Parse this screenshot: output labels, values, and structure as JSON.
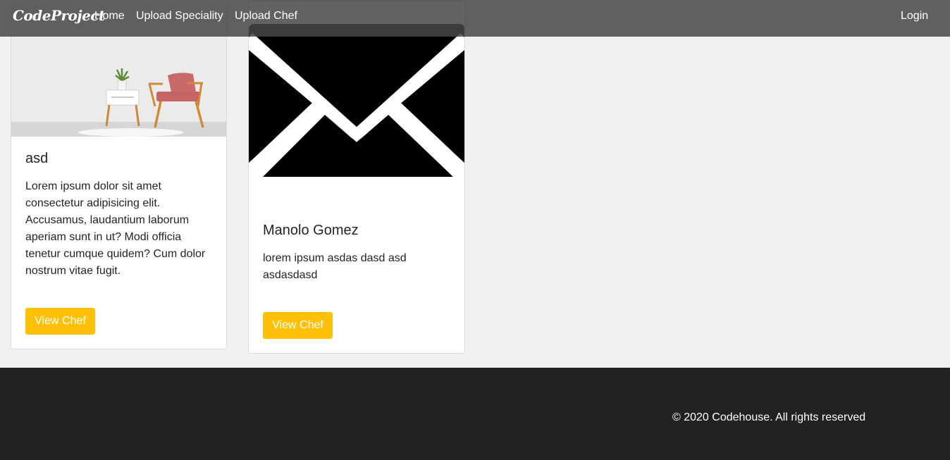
{
  "navbar": {
    "brand": "CodeProject",
    "links": [
      "Home",
      "Upload Speciality",
      "Upload Chef"
    ],
    "login": "Login"
  },
  "cards": [
    {
      "image": "room-chair-photo",
      "title": "asd",
      "text": "Lorem ipsum dolor sit amet consectetur adipisicing elit. Accusamus, laudantium laborum aperiam sunt in ut? Modi officia tenetur cumque quidem? Cum dolor nostrum vitae fugit.",
      "button": "View Chef"
    },
    {
      "image": "envelope-icon",
      "title": "Manolo Gomez",
      "text": "lorem ipsum asdas dasd asd asdasdasd",
      "button": "View Chef"
    }
  ],
  "footer": {
    "copyright": "© 2020 Codehouse. All rights reserved"
  },
  "colors": {
    "accent": "#ffc107",
    "footer_bg": "#222222",
    "page_bg": "#f0f0f0"
  }
}
